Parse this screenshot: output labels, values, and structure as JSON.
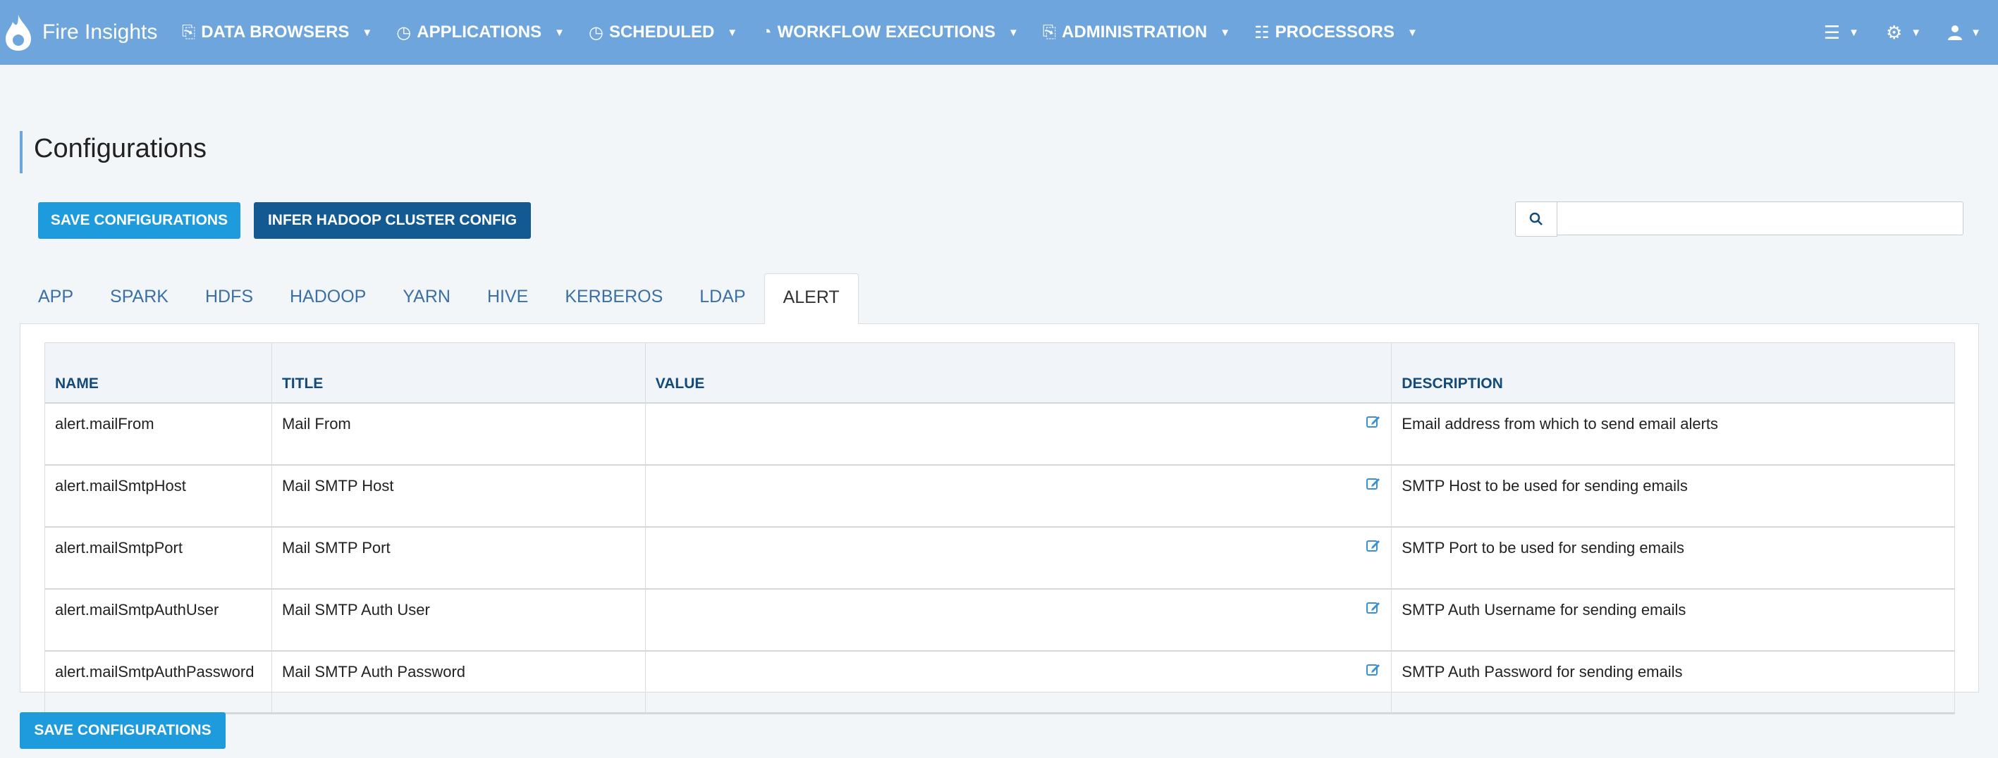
{
  "app": {
    "brand": "Fire Insights"
  },
  "nav": {
    "items": [
      {
        "label": "DATA BROWSERS",
        "icon": "copy-icon"
      },
      {
        "label": "APPLICATIONS",
        "icon": "clock-icon"
      },
      {
        "label": "SCHEDULED",
        "icon": "clock-icon"
      },
      {
        "label": "WORKFLOW EXECUTIONS",
        "icon": "pie-chart-icon"
      },
      {
        "label": "ADMINISTRATION",
        "icon": "copy-icon"
      },
      {
        "label": "PROCESSORS",
        "icon": "grid-icon"
      }
    ],
    "right": [
      "list-icon",
      "settings-icon",
      "user-icon"
    ]
  },
  "page": {
    "title": "Configurations"
  },
  "buttons": {
    "save": "SAVE CONFIGURATIONS",
    "infer": "INFER HADOOP CLUSTER CONFIG"
  },
  "search": {
    "value": "",
    "placeholder": ""
  },
  "tabs": [
    {
      "label": "APP"
    },
    {
      "label": "SPARK"
    },
    {
      "label": "HDFS"
    },
    {
      "label": "HADOOP"
    },
    {
      "label": "YARN"
    },
    {
      "label": "HIVE"
    },
    {
      "label": "KERBEROS"
    },
    {
      "label": "LDAP"
    },
    {
      "label": "ALERT",
      "active": true
    }
  ],
  "table": {
    "columns": [
      "NAME",
      "TITLE",
      "VALUE",
      "DESCRIPTION"
    ],
    "rows": [
      {
        "name": "alert.mailFrom",
        "title": "Mail From",
        "value": "",
        "description": "Email address from which to send email alerts"
      },
      {
        "name": "alert.mailSmtpHost",
        "title": "Mail SMTP Host",
        "value": "",
        "description": "SMTP Host to be used for sending emails"
      },
      {
        "name": "alert.mailSmtpPort",
        "title": "Mail SMTP Port",
        "value": "",
        "description": "SMTP Port to be used for sending emails"
      },
      {
        "name": "alert.mailSmtpAuthUser",
        "title": "Mail SMTP Auth User",
        "value": "",
        "description": "SMTP Auth Username for sending emails"
      },
      {
        "name": "alert.mailSmtpAuthPassword",
        "title": "Mail SMTP Auth Password",
        "value": "",
        "description": "SMTP Auth Password for sending emails"
      }
    ]
  },
  "colors": {
    "navbar": "#6ea5dc",
    "primary_button": "#1e9bdc",
    "dark_button": "#135a93",
    "tab_link": "#3a6fa7",
    "header_text": "#134a7a"
  }
}
